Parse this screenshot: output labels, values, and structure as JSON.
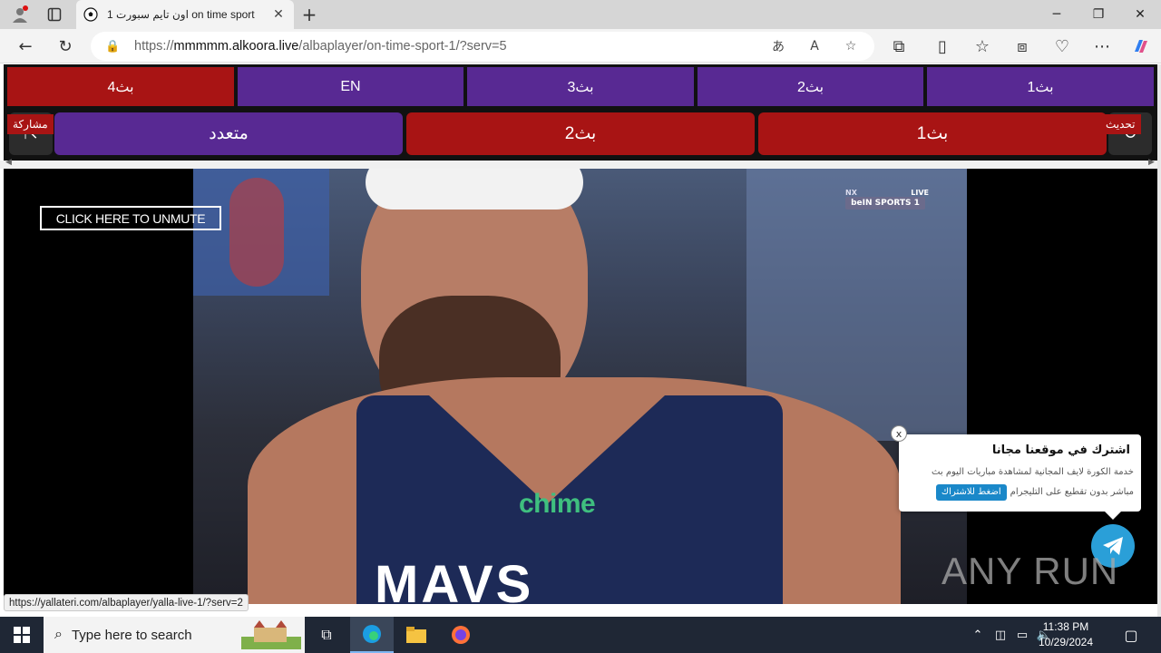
{
  "browser": {
    "tab_title": "اون تايم سبورت 1 on time sport",
    "url_prefix": "https://",
    "url_domain": "mmmmm.alkoora.live",
    "url_path": "/albaplayer/on-time-sport-1/?serv=5",
    "status_url": "https://yallateri.com/albaplayer/yalla-live-1/?serv=2"
  },
  "player": {
    "server_row": [
      {
        "label": "بث4",
        "color": "#a81414",
        "active": true
      },
      {
        "label": "EN",
        "color": "#582993",
        "active": false
      },
      {
        "label": "بث3",
        "color": "#582993",
        "active": false
      },
      {
        "label": "بث2",
        "color": "#582993",
        "active": false
      },
      {
        "label": "بث1",
        "color": "#582993",
        "active": false
      }
    ],
    "quality_row": [
      {
        "label": "متعدد",
        "color": "#582993"
      },
      {
        "label": "بث2",
        "color": "#a81414"
      },
      {
        "label": "بث1",
        "color": "#a81414"
      }
    ],
    "share_label": "مشاركة",
    "refresh_label": "تحديث",
    "unmute_label": "CLICK HERE TO UNMUTE",
    "channel_live": "LIVE",
    "channel_nx": "NX",
    "channel_logo": "beIN SPORTS 1",
    "jersey_sponsor": "chime",
    "jersey_text": "MAVS"
  },
  "popup": {
    "close": "x",
    "title": "اشترك في موقعنا مجانا",
    "body": "خدمة الكورة لايف المجانية لمشاهدة مباريات اليوم بث مباشر بدون تقطيع على التليجرام",
    "button": "اضغط للاشتراك"
  },
  "watermark": "ANY RUN",
  "taskbar": {
    "search_placeholder": "Type here to search",
    "time": "11:38 PM",
    "date": "10/29/2024"
  },
  "colors": {
    "purple": "#582993",
    "red": "#a81414",
    "telegram": "#2a9fd8",
    "taskbar": "#1f2735"
  }
}
